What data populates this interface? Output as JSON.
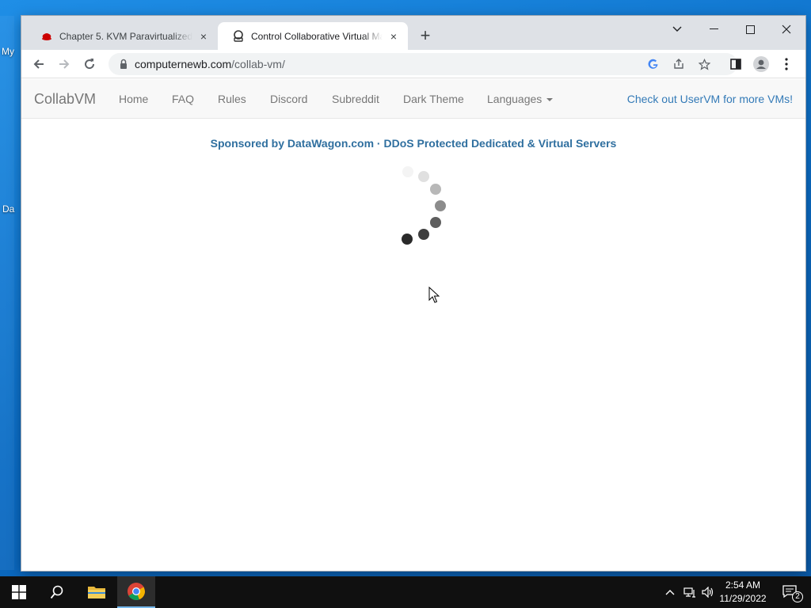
{
  "desktop": {
    "fragments": [
      "My",
      "Da"
    ]
  },
  "browser": {
    "tabs": [
      {
        "title": "Chapter 5. KVM Paravirtualized (v",
        "close": "×",
        "favicon": "redhat-icon"
      },
      {
        "title": "Control Collaborative Virtual Ma",
        "close": "×",
        "favicon": "collabvm-icon"
      }
    ],
    "new_tab": "+",
    "window_controls": {
      "tablist": "⌄",
      "minimize": "—",
      "maximize": "☐",
      "close": "✕"
    },
    "address": {
      "host": "computernewb.com",
      "path": "/collab-vm/"
    }
  },
  "page": {
    "brand": "CollabVM",
    "nav": [
      "Home",
      "FAQ",
      "Rules",
      "Discord",
      "Subreddit",
      "Dark Theme",
      "Languages"
    ],
    "right_link": "Check out UserVM for more VMs!",
    "sponsor": "Sponsored by DataWagon.com · DDoS Protected Dedicated & Virtual Servers"
  },
  "taskbar": {
    "time": "2:54 AM",
    "date": "11/29/2022",
    "notifications": "2",
    "apps": [
      "start-icon",
      "search-icon",
      "file-explorer-icon",
      "chrome-icon"
    ]
  },
  "colors": {
    "desktop": "#0a6bc4",
    "link": "#337ab7",
    "sponsor": "#2f6f9f",
    "taskbar": "#101010"
  }
}
